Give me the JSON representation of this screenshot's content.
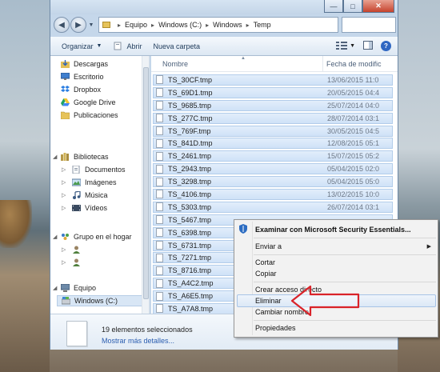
{
  "window": {
    "controls": [
      "—",
      "□",
      "✕"
    ]
  },
  "address": {
    "crumbs": [
      "Equipo",
      "Windows (C:)",
      "Windows",
      "Temp"
    ]
  },
  "toolbar": {
    "organize": "Organizar",
    "open": "Abrir",
    "new_folder": "Nueva carpeta"
  },
  "sidebar": {
    "items": [
      {
        "label": "Descargas",
        "icon": "downloads-icon"
      },
      {
        "label": "Escritorio",
        "icon": "desktop-icon"
      },
      {
        "label": "Dropbox",
        "icon": "dropbox-icon"
      },
      {
        "label": "Google Drive",
        "icon": "google-drive-icon"
      },
      {
        "label": "Publicaciones",
        "icon": "folder-icon"
      },
      {
        "label": "Bibliotecas",
        "icon": "libraries-icon"
      },
      {
        "label": "Documentos",
        "icon": "documents-icon"
      },
      {
        "label": "Imágenes",
        "icon": "pictures-icon"
      },
      {
        "label": "Música",
        "icon": "music-icon"
      },
      {
        "label": "Vídeos",
        "icon": "videos-icon"
      },
      {
        "label": "Grupo en el hogar",
        "icon": "homegroup-icon"
      },
      {
        "label": "",
        "icon": "user-icon"
      },
      {
        "label": "",
        "icon": "user-icon"
      },
      {
        "label": "Equipo",
        "icon": "computer-icon"
      },
      {
        "label": "Windows (C:)",
        "icon": "drive-icon"
      }
    ]
  },
  "columns": {
    "name": "Nombre",
    "date": "Fecha de modific"
  },
  "files": [
    {
      "name": "TS_30CF.tmp",
      "date": "13/06/2015 11:0"
    },
    {
      "name": "TS_69D1.tmp",
      "date": "20/05/2015 04:4"
    },
    {
      "name": "TS_9685.tmp",
      "date": "25/07/2014 04:0"
    },
    {
      "name": "TS_277C.tmp",
      "date": "28/07/2014 03:1"
    },
    {
      "name": "TS_769F.tmp",
      "date": "30/05/2015 04:5"
    },
    {
      "name": "TS_841D.tmp",
      "date": "12/08/2015 05:1"
    },
    {
      "name": "TS_2461.tmp",
      "date": "15/07/2015 05:2"
    },
    {
      "name": "TS_2943.tmp",
      "date": "05/04/2015 02:0"
    },
    {
      "name": "TS_3298.tmp",
      "date": "05/04/2015 05:0"
    },
    {
      "name": "TS_4106.tmp",
      "date": "13/02/2015 10:0"
    },
    {
      "name": "TS_5303.tmp",
      "date": "26/07/2014 03:1"
    },
    {
      "name": "TS_5467.tmp",
      "date": ""
    },
    {
      "name": "TS_6398.tmp",
      "date": ""
    },
    {
      "name": "TS_6731.tmp",
      "date": ""
    },
    {
      "name": "TS_7271.tmp",
      "date": ""
    },
    {
      "name": "TS_8716.tmp",
      "date": ""
    },
    {
      "name": "TS_A4C2.tmp",
      "date": ""
    },
    {
      "name": "TS_A6E5.tmp",
      "date": ""
    },
    {
      "name": "TS_A7A8.tmp",
      "date": ""
    }
  ],
  "details": {
    "count": "19 elementos seleccionados",
    "more": "Mostrar más detalles..."
  },
  "context_menu": {
    "scan": "Examinar con Microsoft Security Essentials...",
    "send_to": "Enviar a",
    "cut": "Cortar",
    "copy": "Copiar",
    "create_shortcut": "Crear acceso directo",
    "delete": "Eliminar",
    "rename": "Cambiar nombre",
    "properties": "Propiedades"
  },
  "colors": {
    "selection": "#cfe2f7",
    "accent": "#2f67c2",
    "arrow": "#d9232a"
  }
}
